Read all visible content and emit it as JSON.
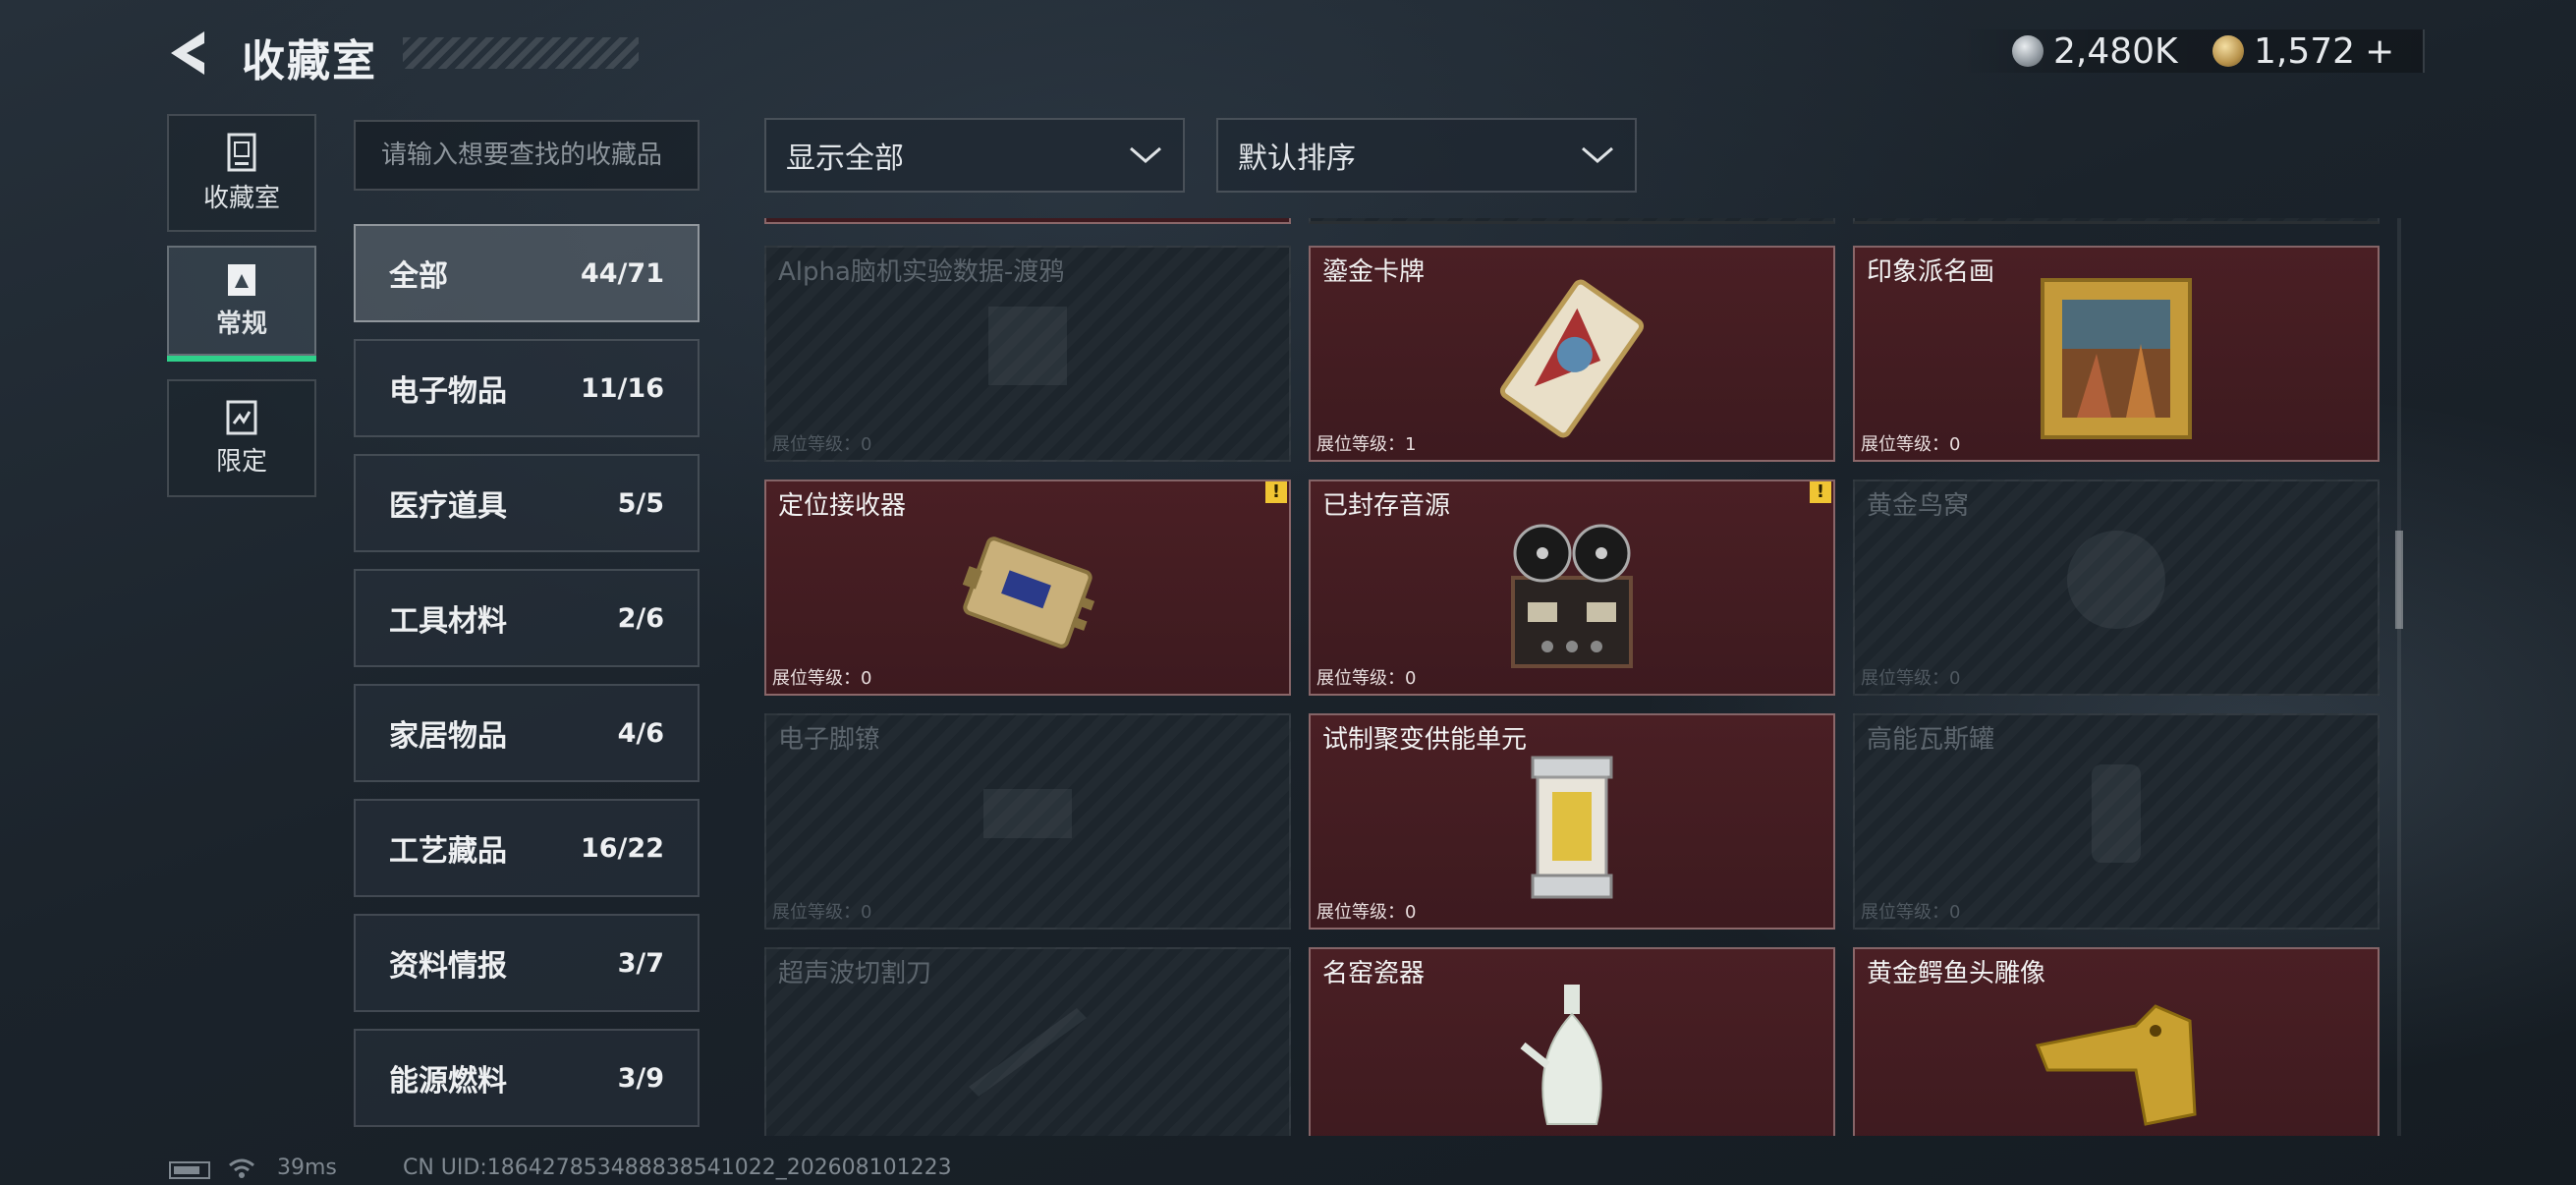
{
  "header": {
    "title": "收藏室"
  },
  "currency": [
    {
      "icon": "silver-coin-icon",
      "value": "2,480K"
    },
    {
      "icon": "gold-coin-icon",
      "value": "1,572",
      "add": "+"
    }
  ],
  "nav": [
    {
      "label": "收藏室",
      "icon": "collection-room-icon"
    },
    {
      "label": "常规",
      "icon": "regular-icon",
      "active": true
    },
    {
      "label": "限定",
      "icon": "limited-icon"
    }
  ],
  "search": {
    "placeholder": "请输入想要查找的收藏品"
  },
  "filters": {
    "show": "显示全部",
    "sort": "默认排序"
  },
  "categories": [
    {
      "name": "全部",
      "count": "44/71",
      "active": true
    },
    {
      "name": "电子物品",
      "count": "11/16"
    },
    {
      "name": "医疗道具",
      "count": "5/5"
    },
    {
      "name": "工具材料",
      "count": "2/6"
    },
    {
      "name": "家居物品",
      "count": "4/6"
    },
    {
      "name": "工艺藏品",
      "count": "16/22"
    },
    {
      "name": "资料情报",
      "count": "3/7"
    },
    {
      "name": "能源燃料",
      "count": "3/9"
    }
  ],
  "items": [
    {
      "name": "Alpha脑机实验数据-渡鸦",
      "level": "展位等级：0",
      "owned": false
    },
    {
      "name": "鎏金卡牌",
      "level": "展位等级：1",
      "owned": true
    },
    {
      "name": "印象派名画",
      "level": "展位等级：0",
      "owned": true
    },
    {
      "name": "定位接收器",
      "level": "展位等级：0",
      "owned": true,
      "alert": "!"
    },
    {
      "name": "已封存音源",
      "level": "展位等级：0",
      "owned": true,
      "alert": "!"
    },
    {
      "name": "黄金鸟窝",
      "level": "展位等级：0",
      "owned": false
    },
    {
      "name": "电子脚镣",
      "level": "展位等级：0",
      "owned": false
    },
    {
      "name": "试制聚变供能单元",
      "level": "展位等级：0",
      "owned": true
    },
    {
      "name": "高能瓦斯罐",
      "level": "展位等级：0",
      "owned": false
    },
    {
      "name": "超声波切割刀",
      "level": "",
      "owned": false
    },
    {
      "name": "名窑瓷器",
      "level": "",
      "owned": true
    },
    {
      "name": "黄金鳄鱼头雕像",
      "level": "",
      "owned": true
    }
  ],
  "footer": {
    "ping": "39ms",
    "uid": "CN UID:18642785348883854​1022_202608101223"
  },
  "colors": {
    "owned_card": "#4a1f24",
    "active_tab": "#2fd08a",
    "alert": "#f0c533"
  }
}
